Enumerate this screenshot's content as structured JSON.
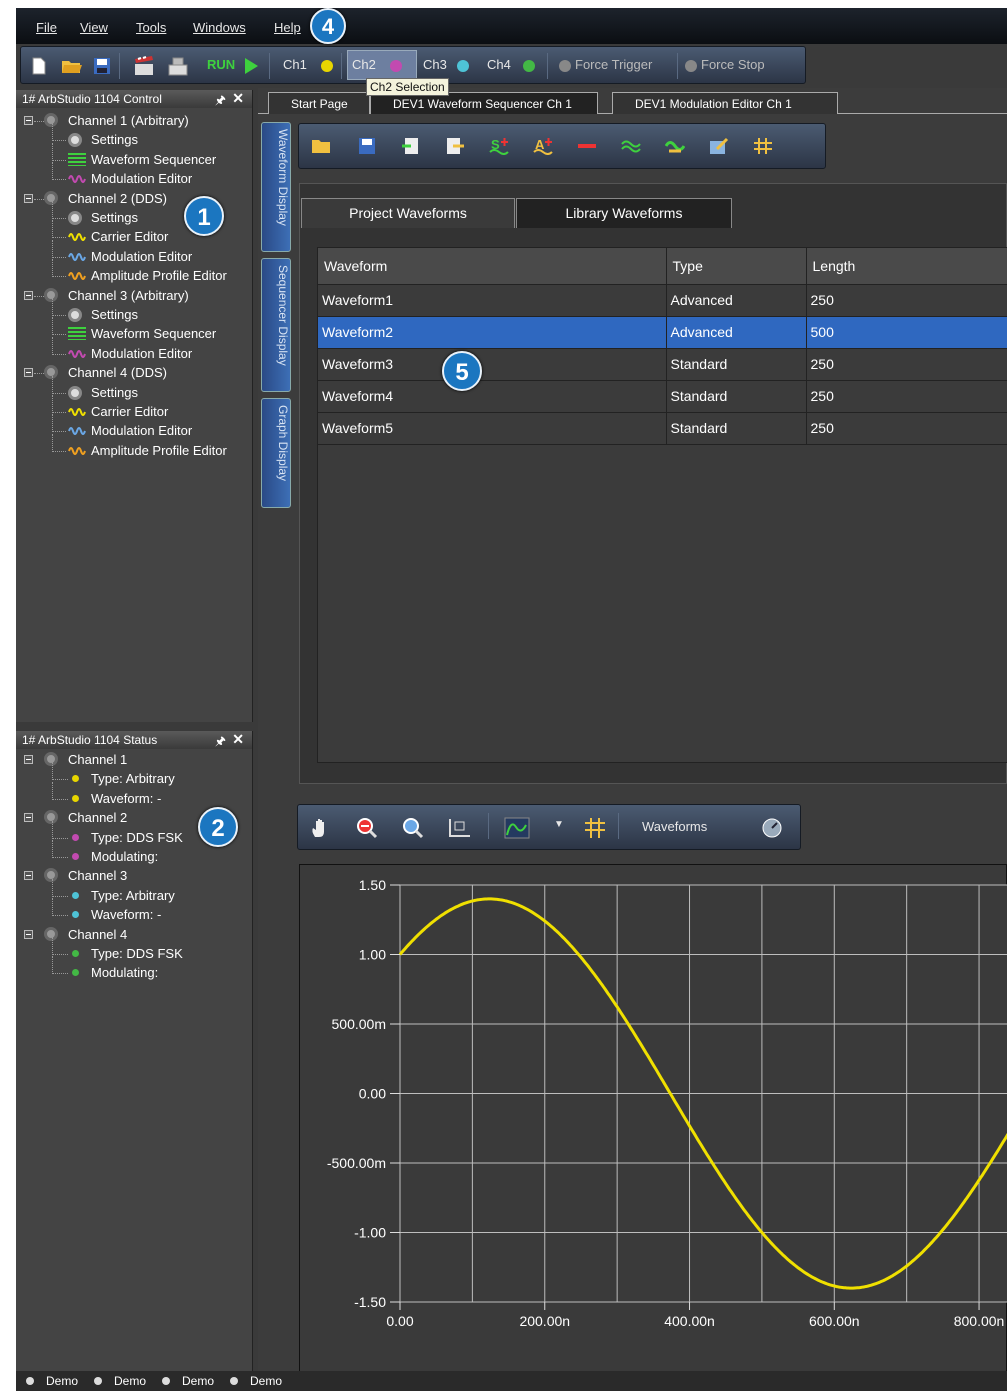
{
  "menu": [
    "File",
    "View",
    "Tools",
    "Windows",
    "Help"
  ],
  "toolbar": {
    "run": "RUN",
    "channels": [
      {
        "label": "Ch1",
        "color": "#e8d600"
      },
      {
        "label": "Ch2",
        "color": "#c24ab0"
      },
      {
        "label": "Ch3",
        "color": "#4ec3d6"
      },
      {
        "label": "Ch4",
        "color": "#43b845"
      }
    ],
    "force_trigger": "Force Trigger",
    "force_stop": "Force Stop",
    "tooltip": "Ch2 Selection"
  },
  "control_panel": {
    "title": "1# ArbStudio 1104 Control",
    "items": [
      {
        "label": "Channel 1 (Arbitrary)",
        "level": 0,
        "icon": "gear-icon"
      },
      {
        "label": "Settings",
        "level": 1,
        "icon": "settings-icon"
      },
      {
        "label": "Waveform Sequencer",
        "level": 1,
        "icon": "sequencer-icon"
      },
      {
        "label": "Modulation Editor",
        "level": 1,
        "icon": "modulation-icon"
      },
      {
        "label": "Channel 2 (DDS)",
        "level": 0,
        "icon": "gear-icon"
      },
      {
        "label": "Settings",
        "level": 1,
        "icon": "settings-icon"
      },
      {
        "label": "Carrier Editor",
        "level": 1,
        "icon": "carrier-icon"
      },
      {
        "label": "Modulation Editor",
        "level": 1,
        "icon": "wave-icon"
      },
      {
        "label": "Amplitude Profile Editor",
        "level": 1,
        "icon": "amplitude-icon"
      },
      {
        "label": "Channel 3 (Arbitrary)",
        "level": 0,
        "icon": "gear-icon"
      },
      {
        "label": "Settings",
        "level": 1,
        "icon": "settings-icon"
      },
      {
        "label": "Waveform Sequencer",
        "level": 1,
        "icon": "sequencer-icon"
      },
      {
        "label": "Modulation Editor",
        "level": 1,
        "icon": "modulation-icon"
      },
      {
        "label": "Channel 4 (DDS)",
        "level": 0,
        "icon": "gear-icon"
      },
      {
        "label": "Settings",
        "level": 1,
        "icon": "settings-icon"
      },
      {
        "label": "Carrier Editor",
        "level": 1,
        "icon": "carrier-icon"
      },
      {
        "label": "Modulation Editor",
        "level": 1,
        "icon": "wave-icon"
      },
      {
        "label": "Amplitude Profile Editor",
        "level": 1,
        "icon": "amplitude-icon"
      }
    ]
  },
  "status_panel": {
    "title": "1# ArbStudio 1104 Status",
    "items": [
      {
        "label": "Channel 1",
        "level": 0,
        "color": ""
      },
      {
        "label": "Type: Arbitrary",
        "level": 1,
        "color": "#e8d600"
      },
      {
        "label": "Waveform: -",
        "level": 1,
        "color": "#e8d600"
      },
      {
        "label": "Channel 2",
        "level": 0,
        "color": ""
      },
      {
        "label": "Type: DDS FSK",
        "level": 1,
        "color": "#c24ab0"
      },
      {
        "label": "Modulating:",
        "level": 1,
        "color": "#c24ab0"
      },
      {
        "label": "Channel 3",
        "level": 0,
        "color": ""
      },
      {
        "label": "Type: Arbitrary",
        "level": 1,
        "color": "#4ec3d6"
      },
      {
        "label": "Waveform: -",
        "level": 1,
        "color": "#4ec3d6"
      },
      {
        "label": "Channel 4",
        "level": 0,
        "color": ""
      },
      {
        "label": "Type: DDS FSK",
        "level": 1,
        "color": "#43b845"
      },
      {
        "label": "Modulating:",
        "level": 1,
        "color": "#43b845"
      }
    ]
  },
  "doc_tabs": [
    "Start Page",
    "DEV1 Waveform Sequencer Ch 1",
    "DEV1 Modulation Editor Ch 1"
  ],
  "vertical_tabs": [
    "Waveform Display",
    "Sequencer Display",
    "Graph Display"
  ],
  "waveform_tabs": [
    "Project Waveforms",
    "Library Waveforms"
  ],
  "table": {
    "headers": [
      "Waveform",
      "Type",
      "Length"
    ],
    "rows": [
      [
        "Waveform1",
        "Advanced",
        "250"
      ],
      [
        "Waveform2",
        "Advanced",
        "500"
      ],
      [
        "Waveform3",
        "Standard",
        "250"
      ],
      [
        "Waveform4",
        "Standard",
        "250"
      ],
      [
        "Waveform5",
        "Standard",
        "250"
      ]
    ],
    "selected_index": 1
  },
  "graph_toolbar": {
    "label": "Waveforms"
  },
  "badges": [
    "1",
    "2",
    "4",
    "5"
  ],
  "chart_data": {
    "type": "line",
    "series": [
      {
        "color": "#f0e000",
        "function": "sin",
        "amplitude": 1.4,
        "offset_phase_rad": 0.7954,
        "period": 1e-06
      }
    ],
    "x_range": [
      0,
      8.4e-07
    ],
    "ylim": [
      -1.5,
      1.5
    ],
    "y_ticks": [
      {
        "v": 1.5,
        "t": "1.50"
      },
      {
        "v": 1.0,
        "t": "1.00"
      },
      {
        "v": 0.5,
        "t": "500.00m"
      },
      {
        "v": 0,
        "t": "0.00"
      },
      {
        "v": -0.5,
        "t": "-500.00m"
      },
      {
        "v": -1.0,
        "t": "-1.00"
      },
      {
        "v": -1.5,
        "t": "-1.50"
      }
    ],
    "x_ticks": [
      {
        "v": 0,
        "t": "0.00"
      },
      {
        "v": 2e-07,
        "t": "200.00n"
      },
      {
        "v": 4e-07,
        "t": "400.00n"
      },
      {
        "v": 6e-07,
        "t": "600.00n"
      },
      {
        "v": 8e-07,
        "t": "800.00n"
      }
    ],
    "grid": true
  },
  "status_bar": [
    "Demo",
    "Demo",
    "Demo",
    "Demo"
  ]
}
